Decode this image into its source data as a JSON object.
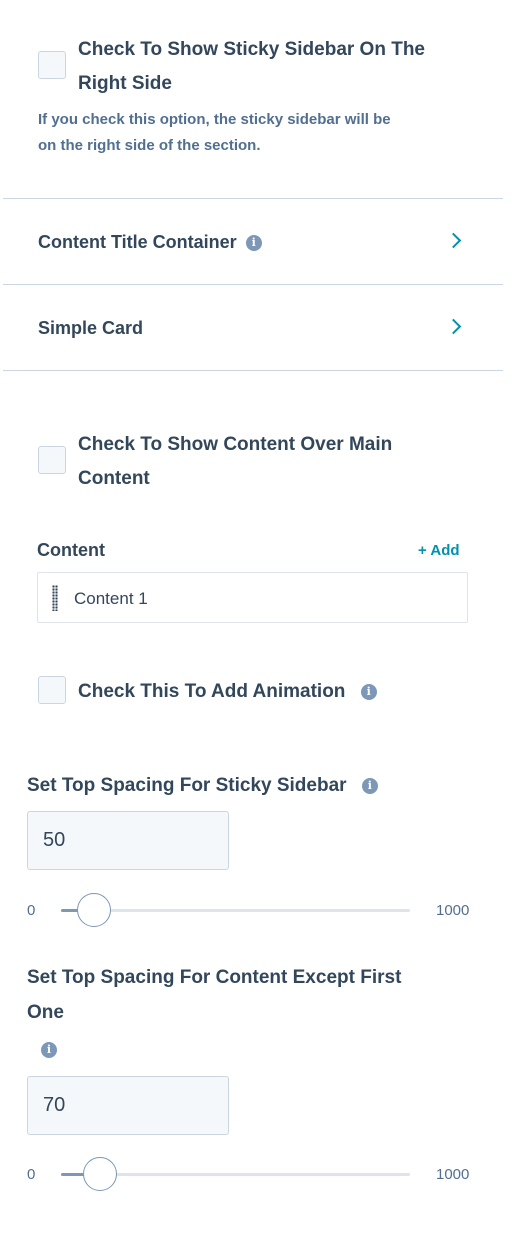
{
  "sticky_right": {
    "label_line1": "Check To Show Sticky Sidebar On The",
    "label_line2": "Right Side",
    "help_line1": "If you check this option, the sticky sidebar will be",
    "help_line2": "on the right side of the section.",
    "checked": false
  },
  "sections": [
    {
      "title": "Content Title Container",
      "has_info": true,
      "icon": "chevron-right-icon"
    },
    {
      "title": "Simple Card",
      "has_info": false,
      "icon": "chevron-right-icon"
    }
  ],
  "content_over": {
    "label_line1": "Check To Show Content Over Main",
    "label_line2": "Content",
    "checked": false
  },
  "content_list": {
    "label": "Content",
    "add_label": "+ Add",
    "items": [
      "Content 1"
    ]
  },
  "animation": {
    "label": "Check This To Add Animation",
    "checked": false
  },
  "top_spacing_sidebar": {
    "label": "Set Top Spacing For Sticky Sidebar",
    "value": "50",
    "min": "0",
    "max": "1000",
    "value_number": 50
  },
  "top_spacing_content": {
    "label_line1": "Set Top Spacing For Content Except First",
    "label_line2": "One",
    "value": "70",
    "min": "0",
    "max": "1000",
    "value_number": 70
  },
  "colors": {
    "text": "#33475b",
    "muted": "#516f90",
    "accent": "#0091ae",
    "border": "#cbd6e2",
    "input_bg": "#f5f8fa"
  }
}
